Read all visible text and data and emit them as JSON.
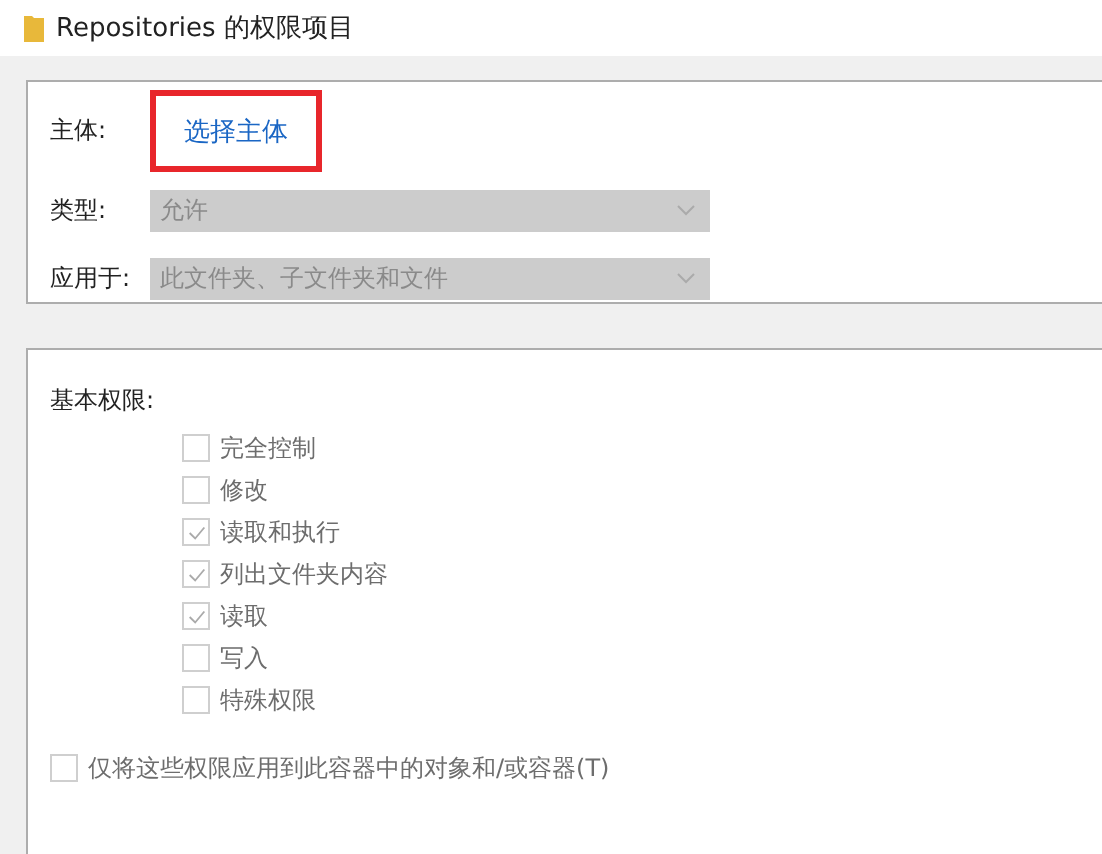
{
  "window": {
    "title": "Repositories 的权限项目"
  },
  "principal": {
    "label": "主体:",
    "link": "选择主体",
    "highlighted": true
  },
  "fields": [
    {
      "label": "类型:",
      "value": "允许",
      "disabled": true
    },
    {
      "label": "应用于:",
      "value": "此文件夹、子文件夹和文件",
      "disabled": true
    }
  ],
  "permissions": {
    "heading": "基本权限:",
    "items": [
      {
        "label": "完全控制",
        "checked": false,
        "disabled": true
      },
      {
        "label": "修改",
        "checked": false,
        "disabled": true
      },
      {
        "label": "读取和执行",
        "checked": true,
        "disabled": true
      },
      {
        "label": "列出文件夹内容",
        "checked": true,
        "disabled": true
      },
      {
        "label": "读取",
        "checked": true,
        "disabled": true
      },
      {
        "label": "写入",
        "checked": false,
        "disabled": true
      },
      {
        "label": "特殊权限",
        "checked": false,
        "disabled": true
      }
    ]
  },
  "apply_only": {
    "label": "仅将这些权限应用到此容器中的对象和/或容器(T)",
    "checked": false,
    "disabled": true
  }
}
